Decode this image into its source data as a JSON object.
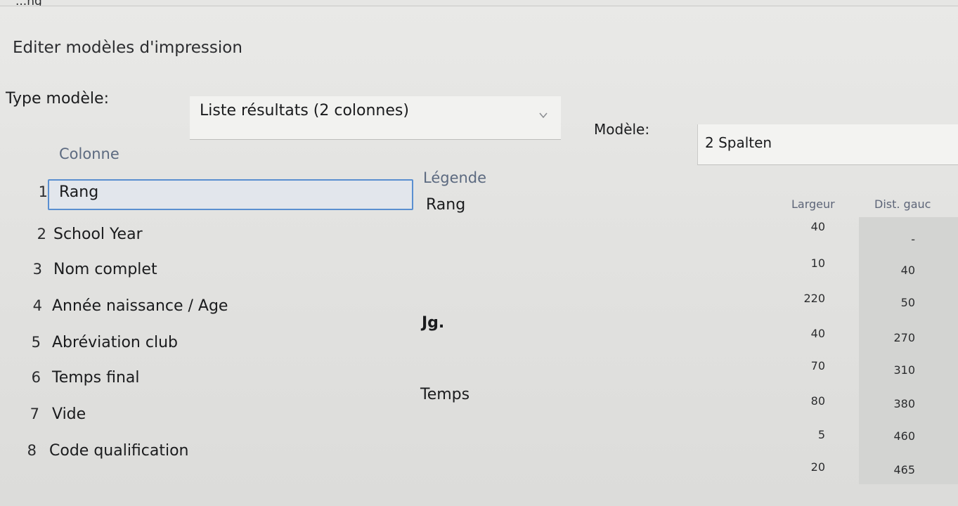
{
  "window": {
    "title": "...ng"
  },
  "dialog": {
    "title": "Editer modèles d'impression",
    "type_label": "Type modèle:",
    "type_value": "Liste résultats (2 colonnes)",
    "model_label": "Modèle:",
    "model_value": "2 Spalten"
  },
  "table": {
    "headers": {
      "colonne": "Colonne",
      "legende": "Légende",
      "largeur": "Largeur",
      "dist": "Dist. gauc"
    },
    "rows": [
      {
        "num": "1",
        "name": "Rang",
        "legend": "Rang",
        "largeur": "40",
        "dist": "-"
      },
      {
        "num": "2",
        "name": "School Year",
        "legend": "",
        "largeur": "10",
        "dist": "40"
      },
      {
        "num": "3",
        "name": "Nom complet",
        "legend": "",
        "largeur": "220",
        "dist": "50"
      },
      {
        "num": "4",
        "name": "Année naissance / Age",
        "legend": "Jg.",
        "largeur": "40",
        "dist": "270"
      },
      {
        "num": "5",
        "name": "Abréviation club",
        "legend": "",
        "largeur": "70",
        "dist": "310"
      },
      {
        "num": "6",
        "name": "Temps final",
        "legend": "Temps",
        "largeur": "80",
        "dist": "380"
      },
      {
        "num": "7",
        "name": "Vide",
        "legend": "",
        "largeur": "5",
        "dist": "460"
      },
      {
        "num": "8",
        "name": "Code qualification",
        "legend": "",
        "largeur": "20",
        "dist": "465"
      }
    ]
  },
  "icons": {
    "dropdown": "chevron-down-icon"
  },
  "colors": {
    "selection_border": "#5a8fd0",
    "header_text": "#5c6a80"
  }
}
